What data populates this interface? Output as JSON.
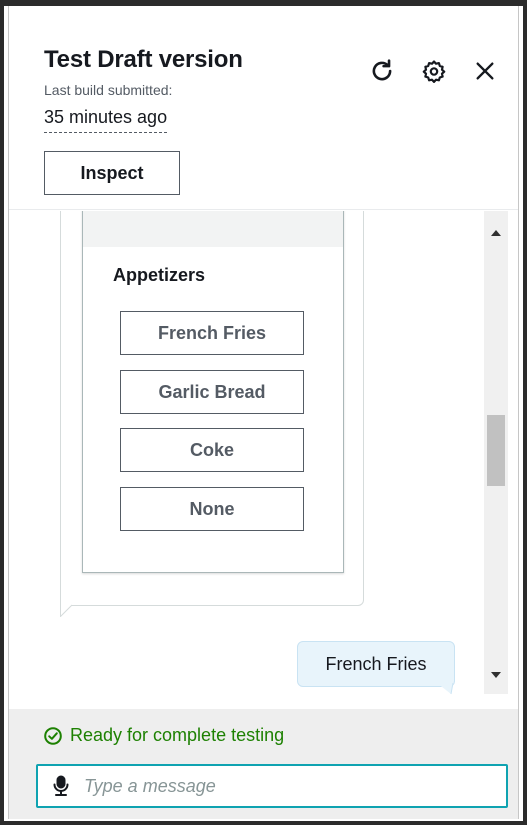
{
  "header": {
    "title": "Test Draft version",
    "subtitle": "Last build submitted:",
    "time_ago": "35 minutes ago",
    "inspect_label": "Inspect",
    "icons": [
      "refresh-icon",
      "settings-icon",
      "close-icon"
    ]
  },
  "chat": {
    "card": {
      "title": "Appetizers",
      "options": [
        "French Fries",
        "Garlic Bread",
        "Coke",
        "None"
      ]
    },
    "user_message": "French Fries"
  },
  "footer": {
    "status": "Ready for complete testing",
    "status_icon": "check-circle-icon",
    "input_placeholder": "Type a message",
    "input_value": "",
    "mic_icon": "microphone-icon"
  },
  "colors": {
    "text": "#16191f",
    "secondary_text": "#545b64",
    "status_green": "#1d8102",
    "input_border": "#0fa3b1",
    "user_bubble": "#e8f4fb",
    "footer_bg": "#eeeeee"
  }
}
